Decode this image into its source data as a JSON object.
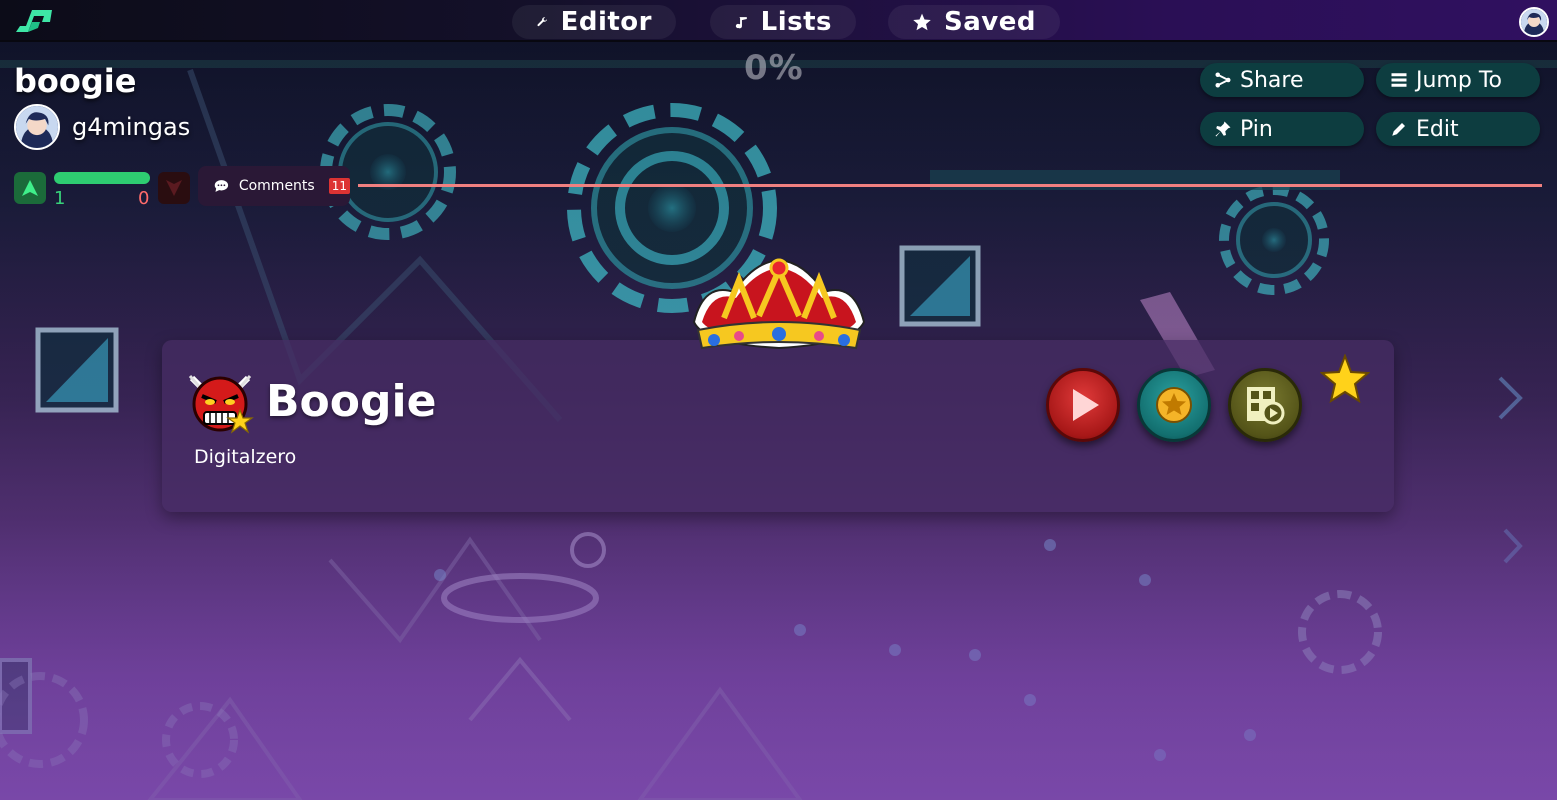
{
  "nav": {
    "logo_icon": "geometry-dash-logo-icon",
    "items": [
      {
        "label": "Editor",
        "icon": "wrench-icon"
      },
      {
        "label": "Lists",
        "icon": "music-note-icon"
      },
      {
        "label": "Saved",
        "icon": "star-icon"
      }
    ],
    "user_avatar_icon": "user-avatar-icon"
  },
  "level": {
    "title": "boogie",
    "creator": "g4mingas",
    "progress_label": "0%",
    "progress_value": 0
  },
  "actions": {
    "share": "Share",
    "jump_to": "Jump To",
    "pin": "Pin",
    "edit": "Edit"
  },
  "rating": {
    "likes": "1",
    "dislikes": "0",
    "like_ratio": 1.0,
    "comments_label": "Comments",
    "comments_count": "11"
  },
  "card": {
    "name": "Boogie",
    "author": "Digitalzero",
    "difficulty_icon": "demon-face-icon",
    "crown_icon": "crown-icon",
    "buttons": [
      "play-button",
      "rate-button",
      "video-button"
    ],
    "favorite_icon": "star-icon"
  },
  "colors": {
    "accent_green": "#2ecc71",
    "dislike_red": "#ff6b6b",
    "action_teal": "#0d3d40",
    "divider_line": "#f08080",
    "star_gold": "#ffd21a"
  }
}
